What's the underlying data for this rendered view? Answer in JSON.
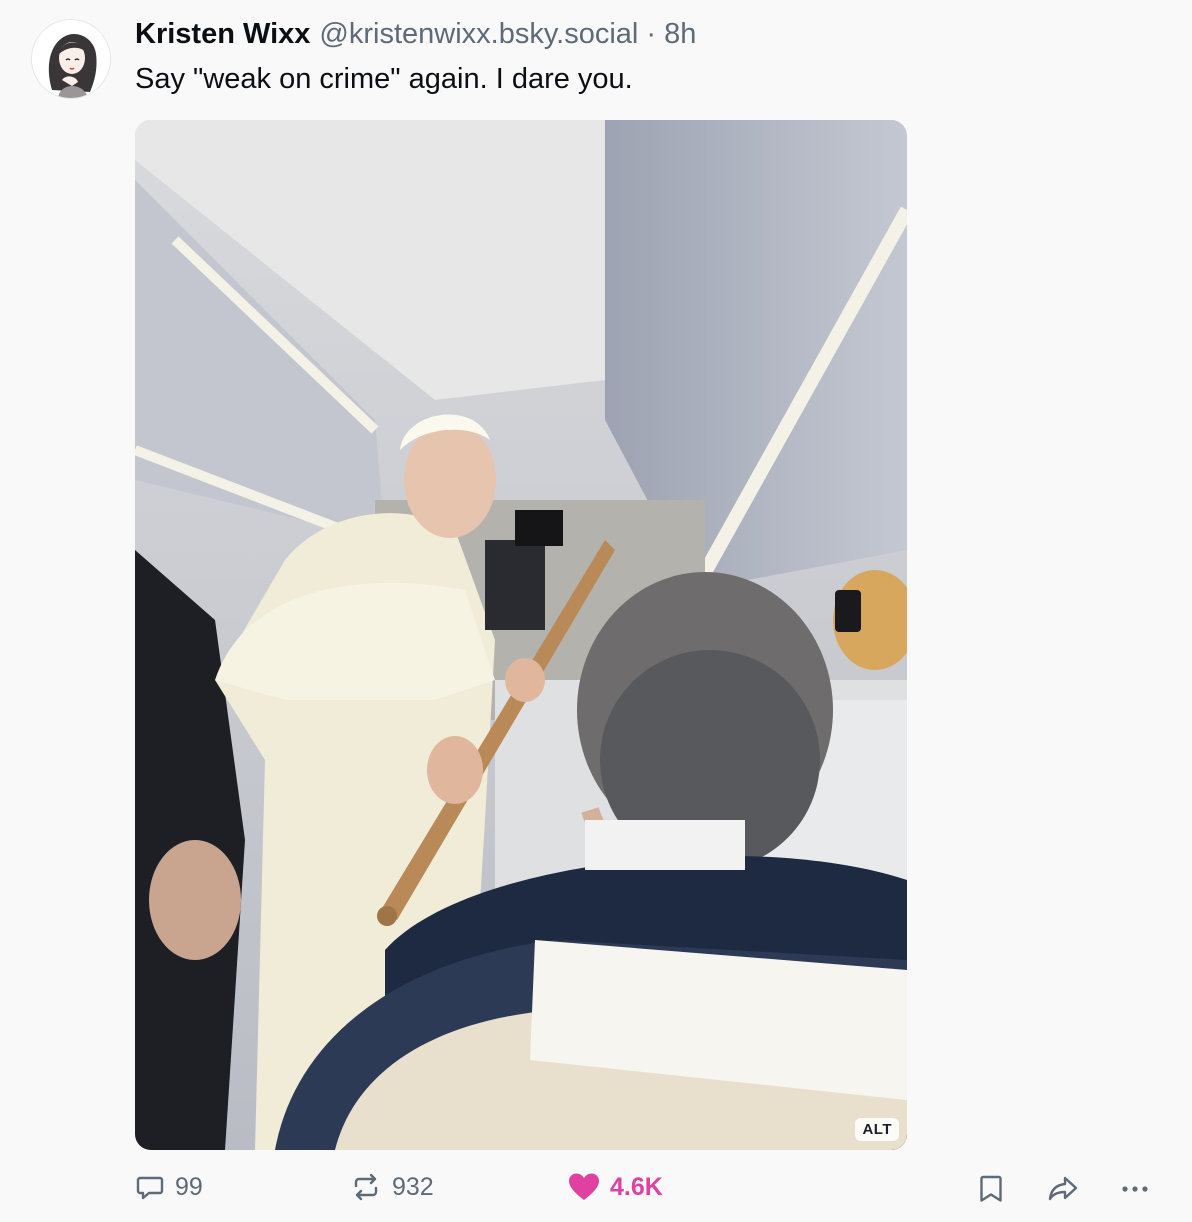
{
  "post": {
    "author": {
      "display_name": "Kristen Wixx",
      "handle": "@kristenwixx.bsky.social",
      "avatar_icon": "avatar-illustration"
    },
    "separator": "·",
    "time": "8h",
    "text": "Say \"weak on crime\" again. I dare you.",
    "image": {
      "alt_badge": "ALT",
      "description_icon": "photo-airplane-cabin"
    },
    "actions": {
      "replies": "99",
      "reposts": "932",
      "likes": "4.6K",
      "reply_icon": "reply-icon",
      "repost_icon": "repost-icon",
      "like_icon": "heart-icon",
      "bookmark_icon": "bookmark-icon",
      "share_icon": "share-icon",
      "more_icon": "more-icon"
    }
  },
  "colors": {
    "background": "#f9f9fa",
    "text": "#0b0f14",
    "muted": "#5e6a77",
    "like": "#e040a0"
  }
}
